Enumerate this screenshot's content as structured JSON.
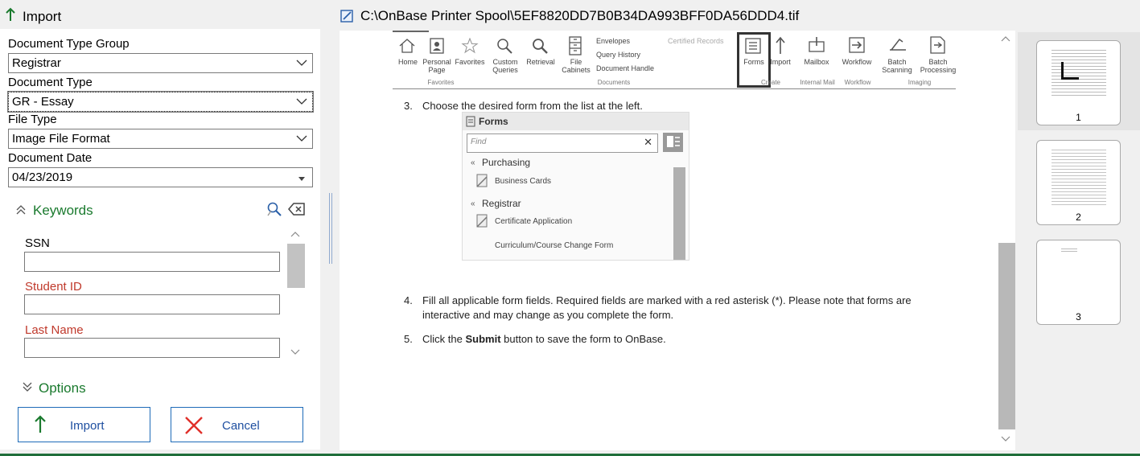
{
  "left_header": {
    "title": "Import"
  },
  "form": {
    "doc_type_group": {
      "label": "Document Type Group",
      "value": "Registrar"
    },
    "doc_type": {
      "label": "Document Type",
      "value": "GR - Essay"
    },
    "file_type": {
      "label": "File Type",
      "value": "Image File Format"
    },
    "doc_date": {
      "label": "Document Date",
      "value": "04/23/2019"
    }
  },
  "keywords": {
    "title": "Keywords",
    "fields": [
      {
        "label": "SSN",
        "value": ""
      },
      {
        "label": "Student ID",
        "value": ""
      },
      {
        "label": "Last Name",
        "value": ""
      }
    ]
  },
  "options": {
    "title": "Options"
  },
  "buttons": {
    "import": "Import",
    "cancel": "Cancel"
  },
  "viewer": {
    "title": "C:\\OnBase Printer Spool\\5EF8820DD7B0B34DA993BFF0DA56DDD4.tif",
    "ribbon": {
      "items": [
        "Home",
        "Personal\nPage",
        "Favorites",
        "Custom\nQueries",
        "Retrieval",
        "File\nCabinets",
        "Forms",
        "Import",
        "Mailbox",
        "Workflow",
        "Batch\nScanning",
        "Batch\nProcessing"
      ],
      "doc_links": [
        "Envelopes",
        "Query History",
        "Document Handle",
        "Certified Records"
      ],
      "groups": [
        "Favorites",
        "Documents",
        "Create",
        "Internal Mail",
        "Workflow",
        "Imaging"
      ]
    },
    "step3": {
      "num": "3.",
      "text": "Choose the desired form from the list at the left."
    },
    "forms_panel": {
      "title": "Forms",
      "find_placeholder": "Find",
      "groups": [
        {
          "name": "Purchasing",
          "items": [
            "Business Cards"
          ]
        },
        {
          "name": "Registrar",
          "items": [
            "Certificate Application",
            "Curriculum/Course Change Form"
          ]
        }
      ]
    },
    "step4": {
      "num": "4.",
      "line1": "Fill all applicable form fields. Required fields are marked with a red asterisk (*). Please note that forms are",
      "line2": "interactive and may change as you complete the form."
    },
    "step5": {
      "num": "5.",
      "pre": "Click the ",
      "bold": "Submit",
      "post": " button to save the form to OnBase."
    }
  },
  "thumbnails": [
    "1",
    "2",
    "3"
  ],
  "colors": {
    "accent_green": "#1a7a2e",
    "required_red": "#c0392b",
    "button_blue": "#1e6bb8",
    "cancel_red": "#e0302a"
  }
}
